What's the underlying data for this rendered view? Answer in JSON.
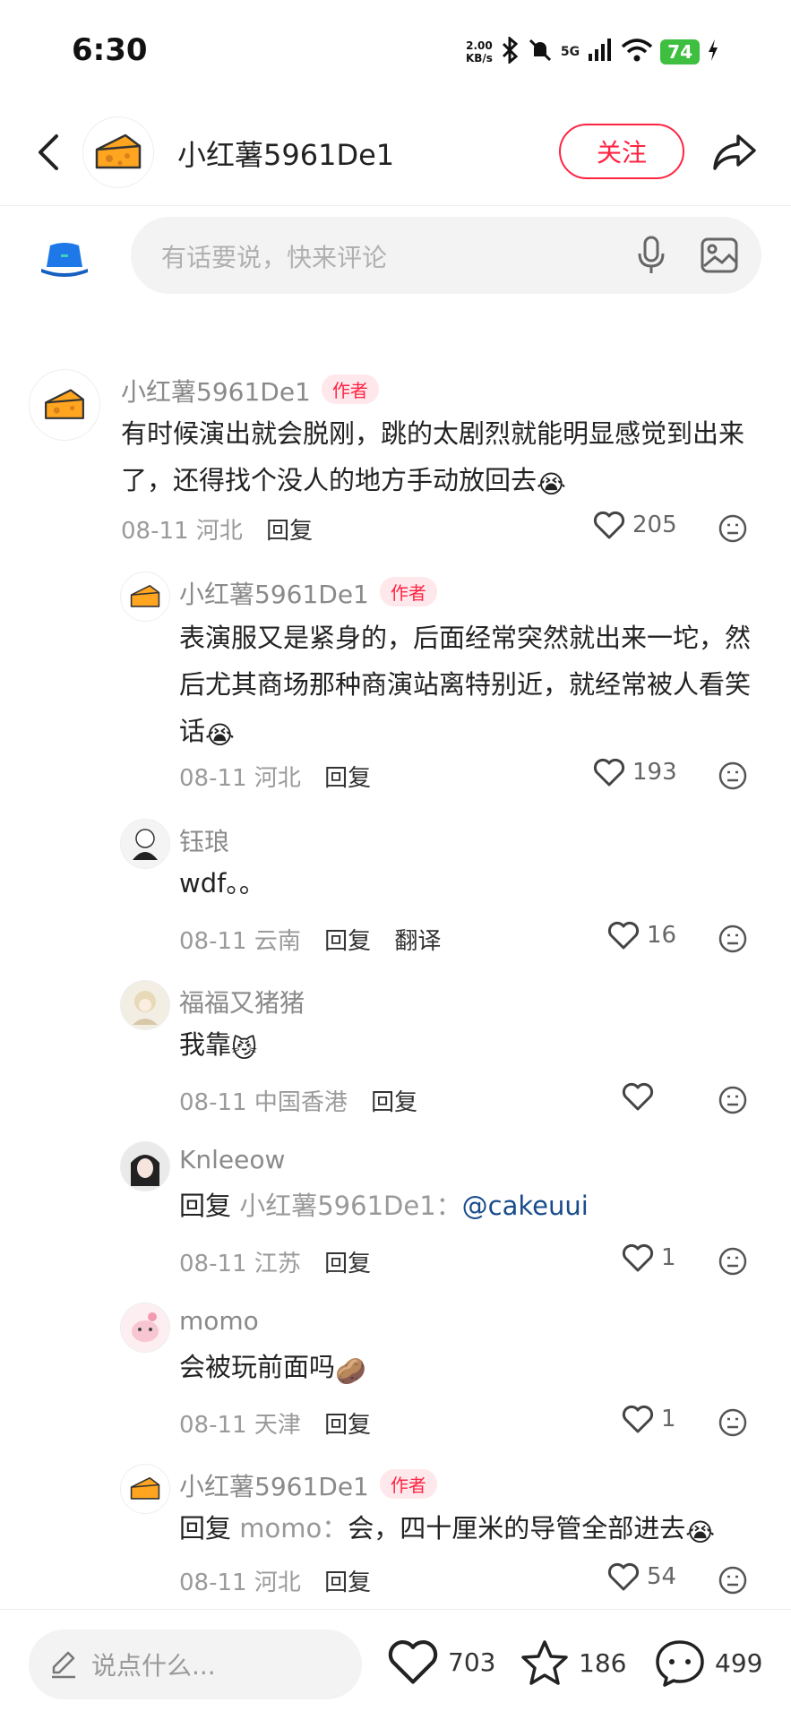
{
  "status_bar": {
    "time": "6:30",
    "net_speed_value": "2.00",
    "net_speed_unit": "KB/s",
    "network": "5G",
    "battery": "74"
  },
  "header": {
    "username": "小红薯5961De1",
    "follow_label": "关注"
  },
  "input": {
    "placeholder": "有话要说，快来评论"
  },
  "comments": [
    {
      "username": "小红薯5961De1",
      "badge": "作者",
      "text": "有时候演出就会脱刚，跳的太剧烈就能明显感觉到出来了，还得找个没人的地方手动放回去",
      "emoji": "😭",
      "date": "08-11",
      "location": "河北",
      "reply_label": "回复",
      "likes": "205"
    },
    {
      "username": "小红薯5961De1",
      "badge": "作者",
      "text": "表演服又是紧身的，后面经常突然就出来一坨，然后尤其商场那种商演站离特别近，就经常被人看笑话",
      "emoji": "😭",
      "date": "08-11",
      "location": "河北",
      "reply_label": "回复",
      "likes": "193"
    },
    {
      "username": "钰琅",
      "text": "wdf。。",
      "date": "08-11",
      "location": "云南",
      "reply_label": "回复",
      "translate_label": "翻译",
      "likes": "16"
    },
    {
      "username": "福福又猪猪",
      "text": "我靠",
      "emoji": "😼",
      "date": "08-11",
      "location": "中国香港",
      "reply_label": "回复",
      "likes": ""
    },
    {
      "username": "Knleeow",
      "reply_prefix": "回复",
      "reply_to": "小红薯5961De1：",
      "text": "@cakeuui",
      "date": "08-11",
      "location": "江苏",
      "reply_label": "回复",
      "likes": "1"
    },
    {
      "username": "momo",
      "text": "会被玩前面吗",
      "emoji": "🥔",
      "date": "08-11",
      "location": "天津",
      "reply_label": "回复",
      "likes": "1"
    },
    {
      "username": "小红薯5961De1",
      "badge": "作者",
      "reply_prefix": "回复",
      "reply_to": "momo：",
      "text": "会，四十厘米的导管全部进去",
      "emoji": "😭",
      "date": "08-11",
      "location": "河北",
      "reply_label": "回复",
      "likes": "54"
    }
  ],
  "bottom_bar": {
    "placeholder": "说点什么...",
    "likes": "703",
    "stars": "186",
    "comments": "499"
  },
  "colors": {
    "accent": "#ff2442",
    "badge_bg": "#ffe8ec",
    "mention": "#1a4c8c"
  }
}
